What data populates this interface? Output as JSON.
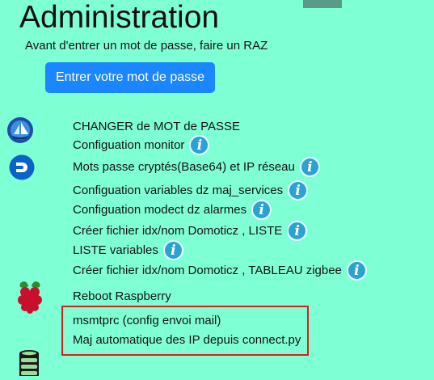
{
  "header": {
    "title": "Administration",
    "subtitle": "Avant d'entrer un mot de passe, faire un RAZ",
    "password_button_label": "Entrer votre mot de passe"
  },
  "menu": {
    "items": [
      {
        "label": "CHANGER de MOT de PASSE",
        "info": false
      },
      {
        "label": "Configuation monitor",
        "info": true
      },
      {
        "label": "Mots passe cryptés(Base64) et IP réseau",
        "info": true
      },
      {
        "label": "Configuation variables dz maj_services",
        "info": true
      },
      {
        "label": "Configuation modect dz alarmes",
        "info": true
      },
      {
        "label": "Créer fichier idx/nom Domoticz , LISTE",
        "info": true
      },
      {
        "label": "LISTE variables",
        "info": true
      },
      {
        "label": "Créer fichier idx/nom Domoticz , TABLEAU zigbee",
        "info": true
      },
      {
        "label": "Reboot Raspberry",
        "info": false
      },
      {
        "label": "msmtprc (config envoi mail)",
        "info": false
      },
      {
        "label": "Maj automatique des IP depuis connect.py",
        "info": false
      }
    ],
    "info_glyph": "i"
  },
  "icons": {
    "sailboat": "sailboat-icon",
    "domoticz": "domoticz-icon",
    "raspberry": "raspberry-pi-icon",
    "database": "database-icon"
  },
  "colors": {
    "background": "#7fffd4",
    "button": "#1a86ff",
    "info": "#2aa2d2",
    "highlight_border": "#e01b1b"
  }
}
